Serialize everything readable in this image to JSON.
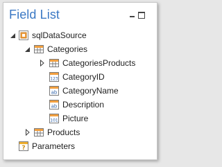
{
  "panel": {
    "title": "Field List",
    "pin_icon": "pin-icon",
    "maximize_icon": "maximize-icon"
  },
  "tree": {
    "datasource": {
      "label": "sqlDataSource",
      "icon": "database-icon",
      "expanded": true
    },
    "categories": {
      "label": "Categories",
      "icon": "table-icon",
      "expanded": true
    },
    "categories_products": {
      "label": "CategoriesProducts",
      "icon": "table-icon",
      "expanded": false
    },
    "category_id": {
      "label": "CategoryID",
      "icon": "numeric-field-icon",
      "type_badge": "123"
    },
    "category_name": {
      "label": "CategoryName",
      "icon": "string-field-icon",
      "type_badge": "ab"
    },
    "description": {
      "label": "Description",
      "icon": "string-field-icon",
      "type_badge": "ab"
    },
    "picture": {
      "label": "Picture",
      "icon": "binary-field-icon",
      "type_badge": "101"
    },
    "products": {
      "label": "Products",
      "icon": "table-icon",
      "expanded": false
    },
    "parameters": {
      "label": "Parameters",
      "icon": "parameters-icon",
      "type_badge": "?"
    }
  },
  "colors": {
    "title": "#3a78c4",
    "table_header": "#f2a040",
    "field_header": "#f2a040",
    "parameter": "#f0b030"
  }
}
